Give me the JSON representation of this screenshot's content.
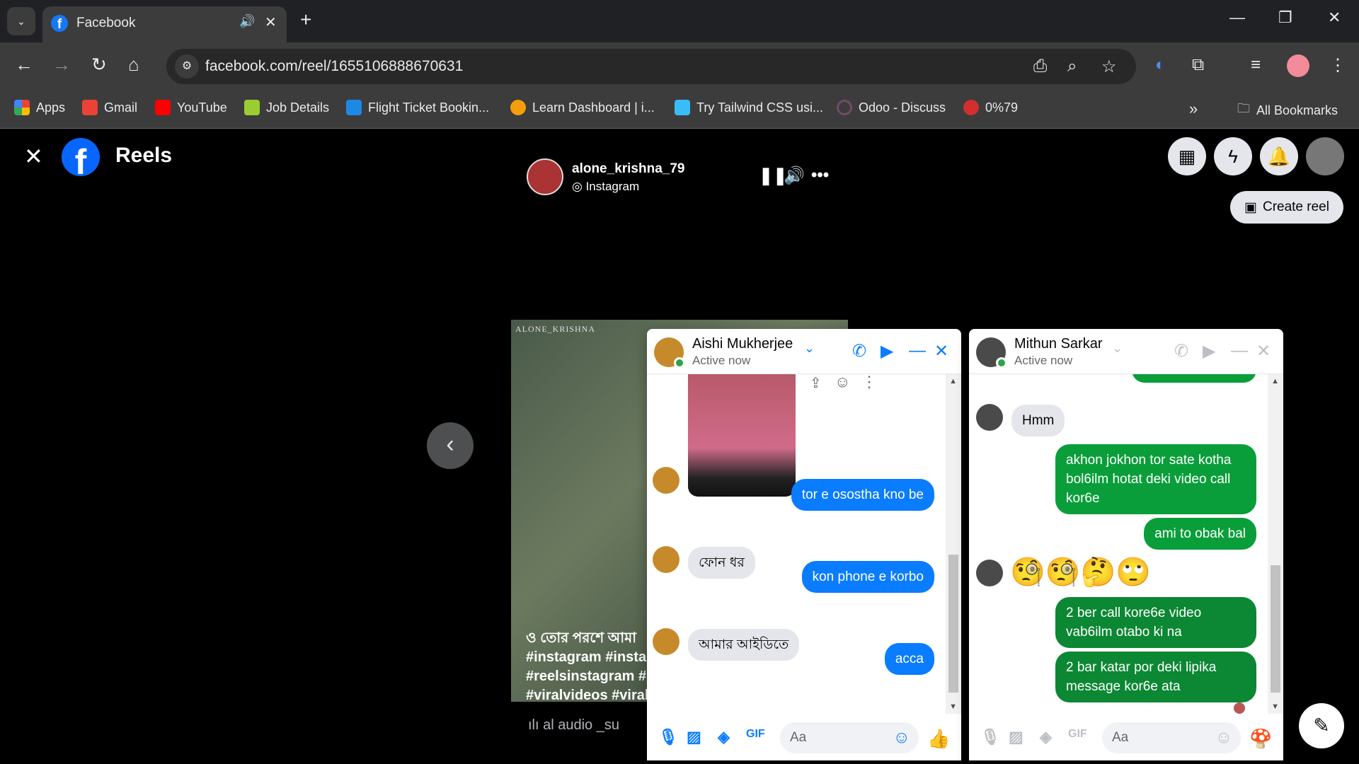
{
  "browser": {
    "tab_title": "Facebook",
    "url": "facebook.com/reel/1655106888670631",
    "bookmarks": [
      {
        "label": "Apps",
        "color": "#ea4335"
      },
      {
        "label": "Gmail",
        "color": "#ea4335"
      },
      {
        "label": "YouTube",
        "color": "#ff0000"
      },
      {
        "label": "Job Details",
        "color": "#9acd32"
      },
      {
        "label": "Flight Ticket Bookin...",
        "color": "#1e88e5"
      },
      {
        "label": "Learn Dashboard | i...",
        "color": "#f59e0b"
      },
      {
        "label": "Try Tailwind CSS usi...",
        "color": "#38bdf8"
      },
      {
        "label": "Odoo - Discuss",
        "color": "#714b67"
      },
      {
        "label": "0%79",
        "color": "#d32f2f"
      }
    ],
    "all_bookmarks": "All Bookmarks",
    "more_bookmarks": "»"
  },
  "page": {
    "title": "Reels",
    "author": {
      "name": "alone_krishna_79",
      "source": "Instagram"
    },
    "create_reel": "Create reel",
    "video_watermark": "ALONE_KRISHNA",
    "caption": [
      "ও তোর পরশে আমা",
      "#instagram #instag",
      "#reelsinstagram #r",
      "#viralvideos #viral"
    ],
    "audio": "al audio      _su"
  },
  "chat1": {
    "name": "Aishi Mukherjee",
    "status": "Active now",
    "messages": [
      {
        "from": "me",
        "text": "tor e osostha kno be"
      },
      {
        "from": "them",
        "text": "ফোন ধর"
      },
      {
        "from": "me",
        "text": "kon phone e korbo"
      },
      {
        "from": "them",
        "text": "আমার আইডিতে"
      },
      {
        "from": "me",
        "text": "acca"
      }
    ],
    "input_placeholder": "Aa"
  },
  "chat2": {
    "name": "Mithun Sarkar",
    "status": "Active now",
    "messages": [
      {
        "from": "them",
        "text": "Hmm"
      },
      {
        "from": "me",
        "text": "akhon jokhon tor sate kotha bol6ilm hotat deki video call kor6e"
      },
      {
        "from": "me",
        "text": "ami to obak bal"
      },
      {
        "from": "them",
        "text": "🧐🧐🤔🙄"
      },
      {
        "from": "me",
        "text": "2 ber call kore6e video vab6ilm otabo ki na"
      },
      {
        "from": "me",
        "text": "2 bar katar por deki lipika message kor6e ata"
      }
    ],
    "input_placeholder": "Aa"
  },
  "colors": {
    "fb_blue": "#0866ff",
    "messenger_blue": "#0a7cff",
    "green": "#0a9e3a"
  }
}
